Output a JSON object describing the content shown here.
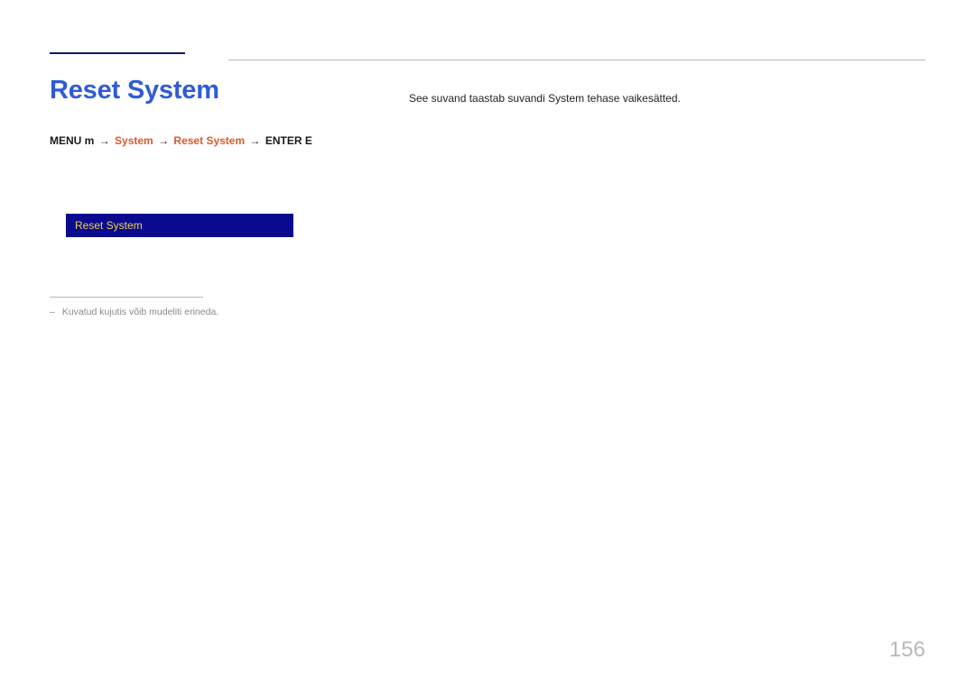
{
  "title": "Reset System",
  "breadcrumb": {
    "prefix": "MENU m",
    "arrow": "→",
    "system": "System",
    "reset_system": "Reset System",
    "enter": "ENTER E"
  },
  "menu": {
    "selected_label": "Reset System"
  },
  "footnote": {
    "dash": "–",
    "text": "Kuvatud kujutis võib mudeliti erineda."
  },
  "body": {
    "description": "See suvand taastab suvandi System tehase vaikesätted."
  },
  "page_number": "156"
}
